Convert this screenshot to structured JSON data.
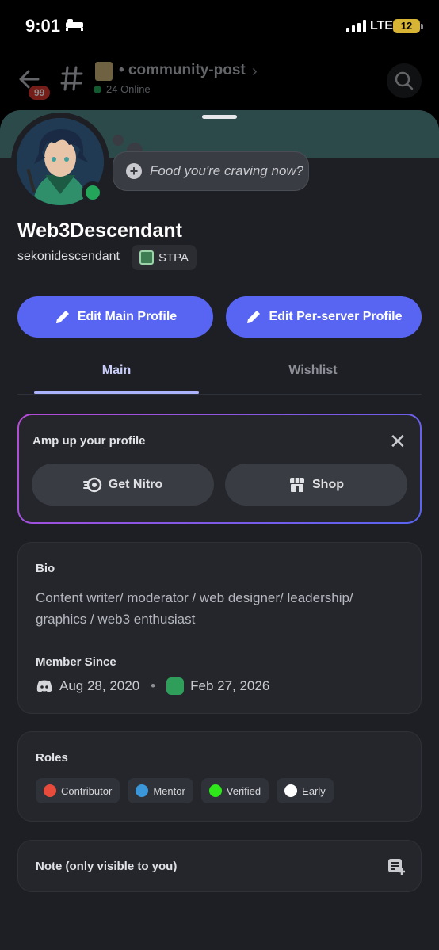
{
  "status_bar": {
    "time": "9:01",
    "network": "LTE",
    "battery": "12"
  },
  "channel_header": {
    "unread_badge": "99",
    "channel_name": "• community-post",
    "online": "24 Online"
  },
  "profile": {
    "status_prompt": "Food you're craving now?",
    "display_name": "Web3Descendant",
    "username": "sekonidescendant",
    "server_tag": "STPA"
  },
  "actions": {
    "edit_main": "Edit Main Profile",
    "edit_server": "Edit Per-server Profile"
  },
  "tabs": [
    {
      "label": "Main",
      "active": true
    },
    {
      "label": "Wishlist",
      "active": false
    }
  ],
  "amp": {
    "title": "Amp up your profile",
    "nitro_label": "Get Nitro",
    "shop_label": "Shop"
  },
  "bio": {
    "label": "Bio",
    "text": "Content writer/ moderator / web designer/ leadership/ graphics / web3 enthusiast",
    "member_since_label": "Member Since",
    "discord_date": "Aug 28, 2020",
    "server_date": "Feb 27, 2026"
  },
  "roles": {
    "label": "Roles",
    "items": [
      {
        "name": "Contributor",
        "color": "#e84b3c"
      },
      {
        "name": "Mentor",
        "color": "#3b97d9"
      },
      {
        "name": "Verified",
        "color": "#2ee81a"
      },
      {
        "name": "Early",
        "color": "#ffffff"
      }
    ]
  },
  "note": {
    "label": "Note (only visible to you)"
  },
  "colors": {
    "accent": "#5865f2",
    "online": "#23a55a",
    "badge": "#d5352e"
  }
}
